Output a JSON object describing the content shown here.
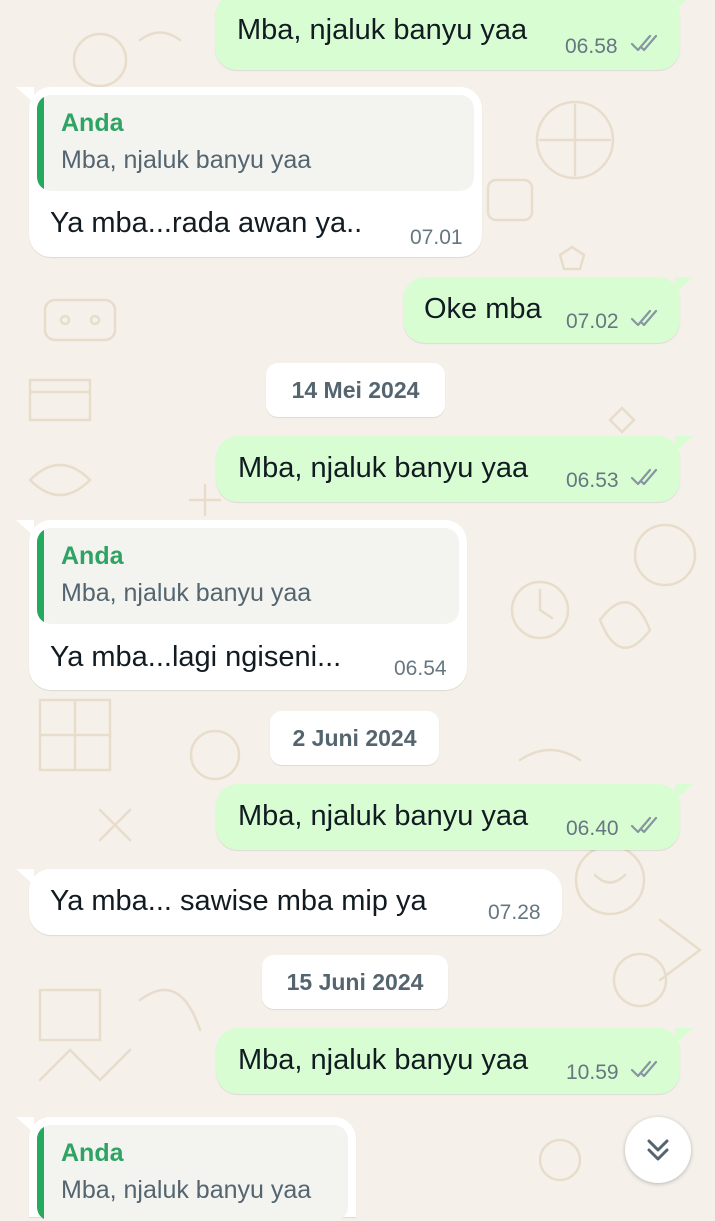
{
  "chat": {
    "messages": [
      {
        "dir": "out",
        "text": "Mba, njaluk banyu yaa",
        "time": "06.58",
        "status": "read"
      },
      {
        "dir": "in",
        "reply": {
          "author": "Anda",
          "text": "Mba, njaluk banyu yaa"
        },
        "text": "Ya mba...rada awan ya..",
        "time": "07.01"
      },
      {
        "dir": "out",
        "text": "Oke mba",
        "time": "07.02",
        "status": "read"
      },
      {
        "date": "14 Mei 2024"
      },
      {
        "dir": "out",
        "text": "Mba, njaluk banyu yaa",
        "time": "06.53",
        "status": "read"
      },
      {
        "dir": "in",
        "reply": {
          "author": "Anda",
          "text": "Mba, njaluk banyu yaa"
        },
        "text": "Ya mba...lagi ngiseni...",
        "time": "06.54"
      },
      {
        "date": "2 Juni 2024"
      },
      {
        "dir": "out",
        "text": "Mba, njaluk banyu yaa",
        "time": "06.40",
        "status": "read"
      },
      {
        "dir": "in",
        "text": "Ya mba... sawise mba mip ya",
        "time": "07.28"
      },
      {
        "date": "15 Juni 2024"
      },
      {
        "dir": "out",
        "text": "Mba, njaluk banyu yaa",
        "time": "10.59",
        "status": "read"
      },
      {
        "dir": "in",
        "reply": {
          "author": "Anda",
          "text": "Mba, njaluk banyu yaa"
        },
        "text": "",
        "time": ""
      }
    ],
    "scroll_button_icon": "double-chevron-down-icon"
  },
  "colors": {
    "outgoing_bubble": "#d9fdd3",
    "incoming_bubble": "#ffffff",
    "reply_accent": "#25a95f",
    "reply_author": "#2ea363",
    "read_ticks": "#8696a0",
    "wallpaper": "#f5f1ea"
  }
}
